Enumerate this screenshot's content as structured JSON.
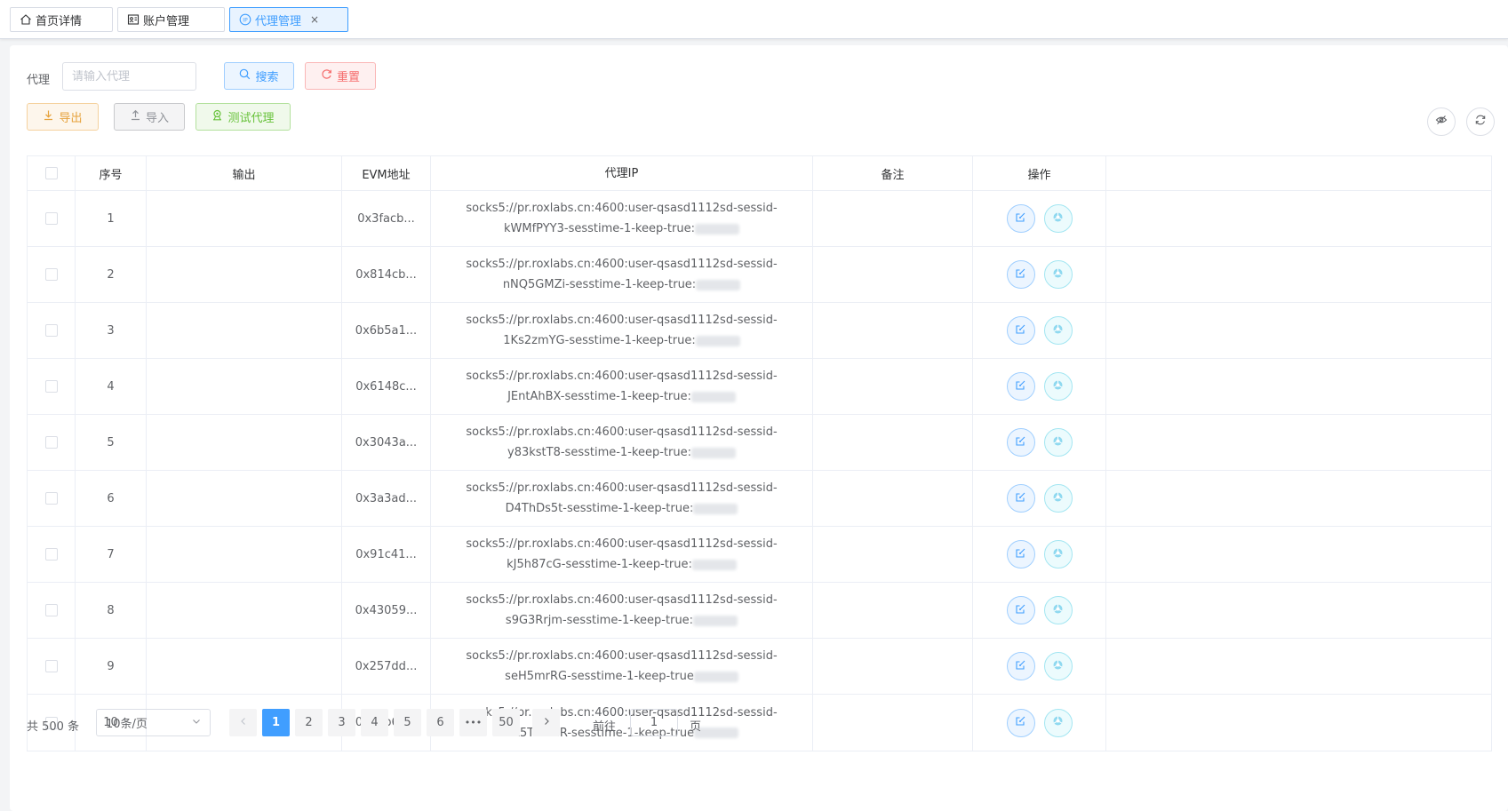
{
  "tabs": [
    {
      "label": "首页详情",
      "icon": "home-icon"
    },
    {
      "label": "账户管理",
      "icon": "account-card-icon"
    },
    {
      "label": "代理管理",
      "icon": "ip-icon",
      "close": "×"
    }
  ],
  "filter": {
    "label": "代理",
    "placeholder": "请输入代理",
    "value": "",
    "search_label": "搜索",
    "reset_label": "重置"
  },
  "toolbar": {
    "export_label": "导出",
    "import_label": "导入",
    "test_label": "测试代理"
  },
  "table": {
    "headers": {
      "index": "序号",
      "output": "输出",
      "evm": "EVM地址",
      "ip": "代理IP",
      "note": "备注",
      "ops": "操作"
    },
    "rows": [
      {
        "index": "1",
        "output": "",
        "evm": "0x3facb...",
        "ip_line1": "socks5://pr.roxlabs.cn:4600:user-qsasd1112sd-sessid-",
        "ip_line2": "kWMfPYY3-sesstime-1-keep-true:",
        "note": ""
      },
      {
        "index": "2",
        "output": "",
        "evm": "0x814cb...",
        "ip_line1": "socks5://pr.roxlabs.cn:4600:user-qsasd1112sd-sessid-",
        "ip_line2": "nNQ5GMZi-sesstime-1-keep-true:",
        "note": ""
      },
      {
        "index": "3",
        "output": "",
        "evm": "0x6b5a1...",
        "ip_line1": "socks5://pr.roxlabs.cn:4600:user-qsasd1112sd-sessid-",
        "ip_line2": "1Ks2zmYG-sesstime-1-keep-true:",
        "note": ""
      },
      {
        "index": "4",
        "output": "",
        "evm": "0x6148c...",
        "ip_line1": "socks5://pr.roxlabs.cn:4600:user-qsasd1112sd-sessid-",
        "ip_line2": "JEntAhBX-sesstime-1-keep-true:",
        "note": ""
      },
      {
        "index": "5",
        "output": "",
        "evm": "0x3043a...",
        "ip_line1": "socks5://pr.roxlabs.cn:4600:user-qsasd1112sd-sessid-",
        "ip_line2": "y83kstT8-sesstime-1-keep-true:",
        "note": ""
      },
      {
        "index": "6",
        "output": "",
        "evm": "0x3a3ad...",
        "ip_line1": "socks5://pr.roxlabs.cn:4600:user-qsasd1112sd-sessid-",
        "ip_line2": "D4ThDs5t-sesstime-1-keep-true:",
        "note": ""
      },
      {
        "index": "7",
        "output": "",
        "evm": "0x91c41...",
        "ip_line1": "socks5://pr.roxlabs.cn:4600:user-qsasd1112sd-sessid-",
        "ip_line2": "kJ5h87cG-sesstime-1-keep-true:",
        "note": ""
      },
      {
        "index": "8",
        "output": "",
        "evm": "0x43059...",
        "ip_line1": "socks5://pr.roxlabs.cn:4600:user-qsasd1112sd-sessid-",
        "ip_line2": "s9G3Rrjm-sesstime-1-keep-true:",
        "note": ""
      },
      {
        "index": "9",
        "output": "",
        "evm": "0x257dd...",
        "ip_line1": "socks5://pr.roxlabs.cn:4600:user-qsasd1112sd-sessid-",
        "ip_line2": "seH5mrRG-sesstime-1-keep-true",
        "note": ""
      },
      {
        "index": "10",
        "output": "",
        "evm": "0xdbb6a...",
        "ip_line1": "socks5://pr.roxlabs.cn:4600:user-qsasd1112sd-sessid-",
        "ip_line2": "EA5TNw2R-sesstime-1-keep-true",
        "note": ""
      }
    ]
  },
  "pagination": {
    "total_label": "共 500 条",
    "page_size": "10条/页",
    "pages": [
      "1",
      "2",
      "3",
      "4",
      "5",
      "6",
      "•••",
      "50"
    ],
    "current": "1",
    "goto_label": "前往",
    "goto_value": "1",
    "page_suffix": "页"
  },
  "colors": {
    "primary": "#409eff",
    "danger": "#f56c6c",
    "warning": "#e6a23c",
    "success": "#67c23a",
    "info": "#909399"
  }
}
